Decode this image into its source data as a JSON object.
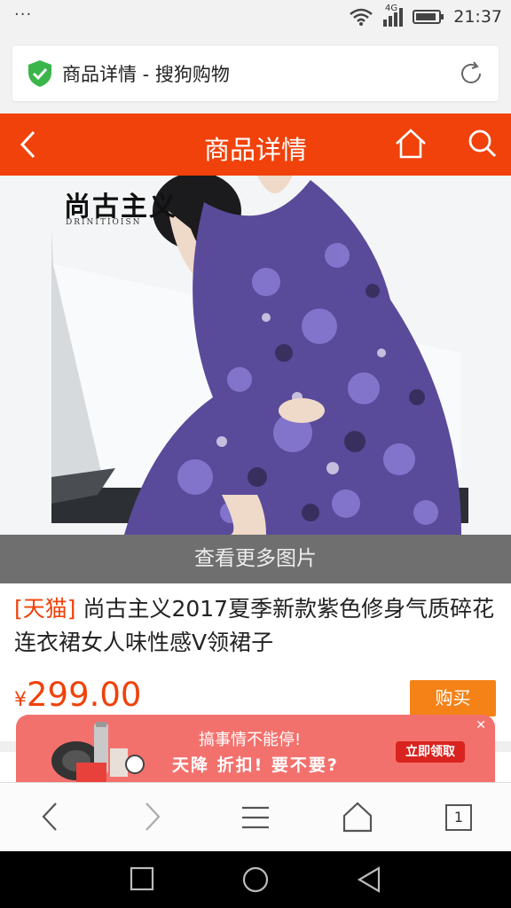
{
  "status_bar": {
    "dots": "···",
    "network": "4G",
    "time": "21:37"
  },
  "address_bar": {
    "page_title": "商品详情 - 搜狗购物",
    "secure_icon": "shield-check-icon",
    "reload_icon": "reload-icon"
  },
  "header": {
    "title": "商品详情",
    "back_icon": "back-arrow-icon",
    "home_icon": "home-icon",
    "search_icon": "search-icon",
    "color": "#f0420a"
  },
  "product": {
    "image_brand": "尚古主义",
    "image_brand_sub": "DRINITIOISN",
    "more_images_label": "查看更多图片",
    "store_tag": "[天猫]",
    "title": "尚古主义2017夏季新款紫色修身气质碎花连衣裙女人味性感V领裙子",
    "currency": "¥",
    "price": "299.00",
    "buy_label": "购买",
    "buy_color": "#f58217"
  },
  "promo": {
    "line1": "搞事情不能停!",
    "line2": "天降 折扣! 要不要?",
    "claim_label": "立即领取",
    "close_icon": "close-icon"
  },
  "browser_toolbar": {
    "items": [
      "back-icon",
      "forward-icon",
      "menu-icon",
      "home-icon"
    ],
    "tab_count": "1"
  },
  "system_nav": {
    "items": [
      "recent-apps-icon",
      "home-circle-icon",
      "back-triangle-icon"
    ]
  }
}
